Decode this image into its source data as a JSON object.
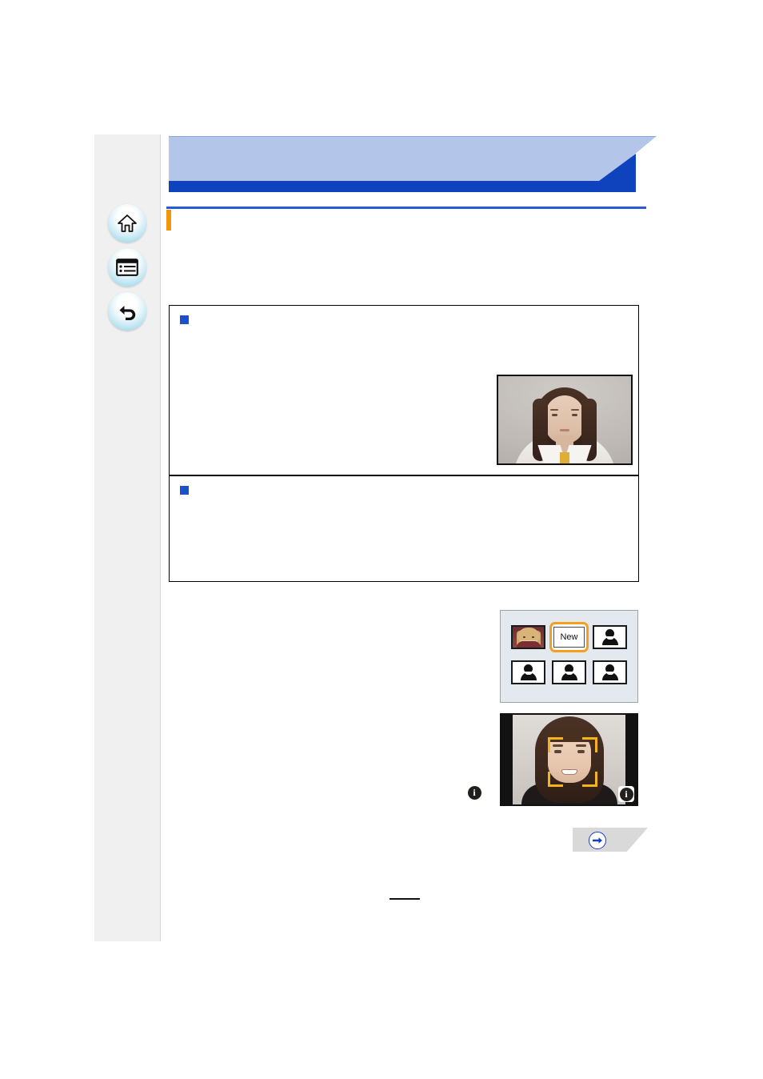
{
  "document": {
    "type": "camera-user-manual-page",
    "page_number": "",
    "colors": {
      "banner_light": "#b3c6ea",
      "banner_dark": "#0f42bd",
      "heading_rule": "#2a5bd7",
      "heading_marker": "#f2950d",
      "bullet": "#1a50c8",
      "selection_highlight": "#f2a01e",
      "af_bracket": "#f5b31c",
      "sidebar_bg": "#f0f0f0",
      "panel_bg": "#e3e9ef",
      "next_button_bg": "#d9d9d9",
      "next_button_arrow": "#1a3fbd"
    }
  },
  "sidebar": {
    "items": [
      {
        "name": "home-button",
        "icon": "home-icon",
        "label": ""
      },
      {
        "name": "menu-button",
        "icon": "menu-list-icon",
        "label": ""
      },
      {
        "name": "back-button",
        "icon": "back-arrow-icon",
        "label": ""
      }
    ]
  },
  "header": {
    "title": ""
  },
  "section": {
    "heading": "",
    "intro": ""
  },
  "note_boxes": [
    {
      "title": "",
      "body": ""
    },
    {
      "title": "",
      "body": ""
    }
  ],
  "steps": {
    "text": ""
  },
  "figures": {
    "portrait_photo": {
      "name": "portrait-photo",
      "caption": "",
      "description": "woman facing camera, white shirt, gray background"
    },
    "face_registration_panel": {
      "name": "face-registration-panel",
      "slots": [
        {
          "type": "registered",
          "label": "",
          "selected": false
        },
        {
          "type": "new",
          "label": "New",
          "selected": true
        },
        {
          "type": "empty",
          "label": "",
          "selected": false
        },
        {
          "type": "empty",
          "label": "",
          "selected": false
        },
        {
          "type": "empty",
          "label": "",
          "selected": false
        },
        {
          "type": "empty",
          "label": "",
          "selected": false
        }
      ]
    },
    "face_detection_shot": {
      "name": "face-detection-shot",
      "af_frame": true,
      "info_badge": "i",
      "caption": ""
    },
    "inline_info_icon": {
      "name": "info-icon",
      "glyph": "i"
    }
  },
  "next_page_button": {
    "label": "",
    "icon": "arrow-right-circle-icon"
  },
  "footer": {
    "page_number": ""
  }
}
